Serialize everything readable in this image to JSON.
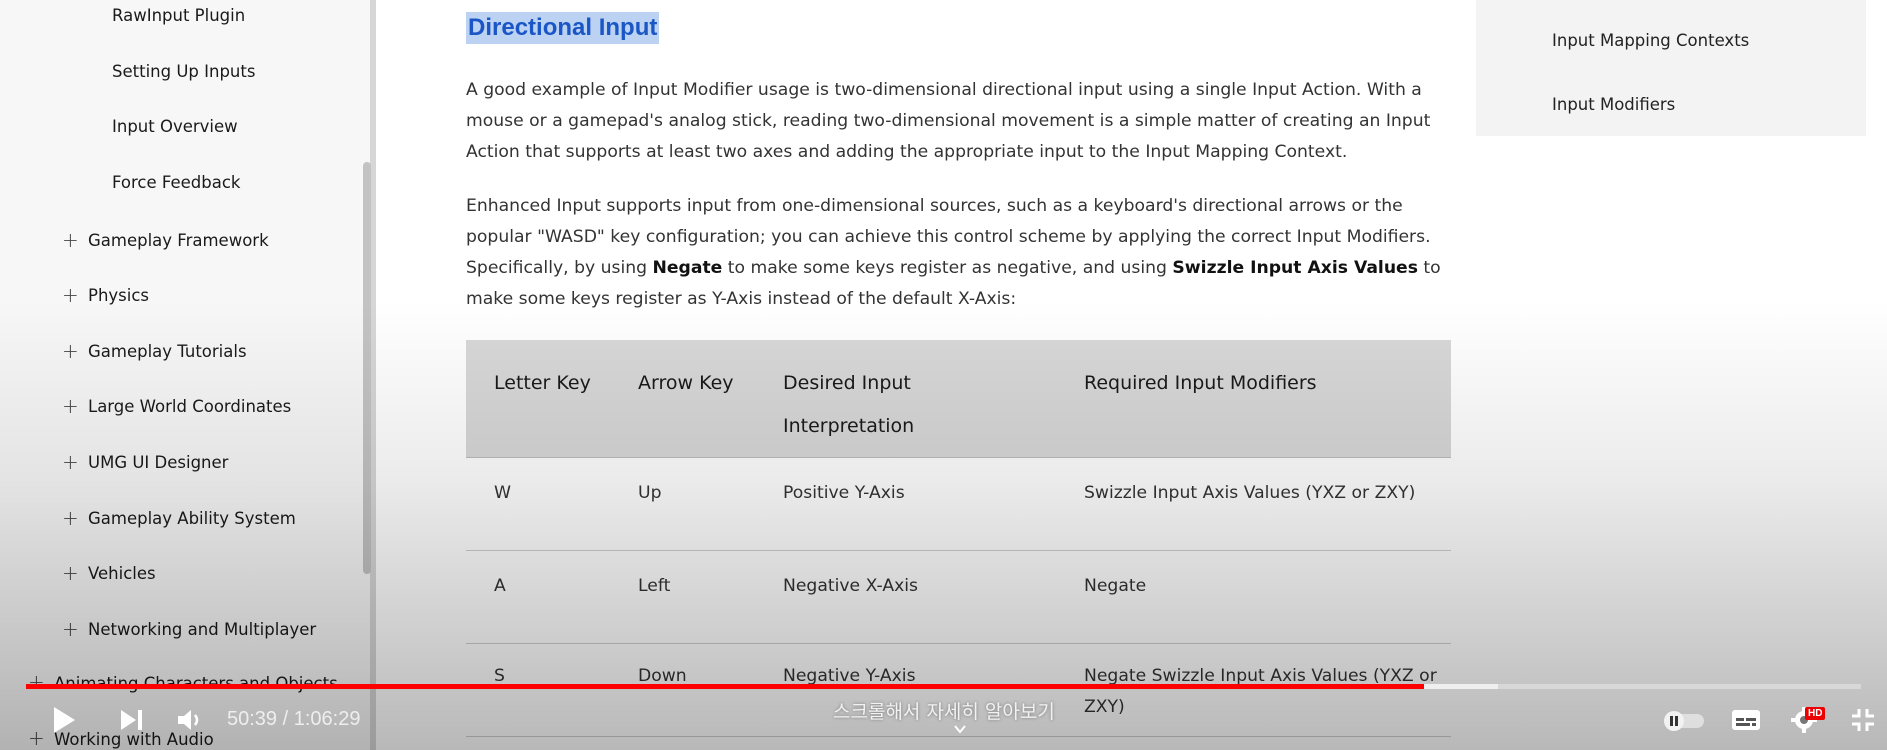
{
  "sidebar": {
    "sub_items": [
      {
        "label": "RawInput Plugin"
      },
      {
        "label": "Setting Up Inputs"
      },
      {
        "label": "Input Overview"
      },
      {
        "label": "Force Feedback"
      }
    ],
    "top_items": [
      {
        "label": "Gameplay Framework"
      },
      {
        "label": "Physics"
      },
      {
        "label": "Gameplay Tutorials"
      },
      {
        "label": "Large World Coordinates"
      },
      {
        "label": "UMG UI Designer"
      },
      {
        "label": "Gameplay Ability System"
      },
      {
        "label": "Vehicles"
      },
      {
        "label": "Networking and Multiplayer"
      }
    ],
    "root_items": [
      {
        "label": "Animating Characters and Objects"
      },
      {
        "label": "Working with Audio"
      }
    ]
  },
  "main": {
    "heading": "Directional Input",
    "para1": "A good example of Input Modifier usage is two-dimensional directional input using a single Input Action. With a mouse or a gamepad's analog stick, reading two-dimensional movement is a simple matter of creating an Input Action that supports at least two axes and adding the appropriate input to the Input Mapping Context.",
    "para2": {
      "part1": "Enhanced Input supports input from one-dimensional sources, such as a keyboard's directional arrows or the popular \"WASD\" key configuration; you can achieve this control scheme by applying the correct Input Modifiers. Specifically, by using ",
      "bold1": "Negate",
      "part2": " to make some keys register as negative, and using ",
      "bold2": "Swizzle Input Axis Values",
      "part3": " to make some keys register as Y-Axis instead of the default X-Axis:"
    },
    "table": {
      "headers": [
        "Letter Key",
        "Arrow Key",
        "Desired Input Interpretation",
        "Required Input Modifiers"
      ],
      "rows": [
        [
          "W",
          "Up",
          "Positive Y-Axis",
          "Swizzle Input Axis Values (YXZ or ZXY)"
        ],
        [
          "A",
          "Left",
          "Negative X-Axis",
          "Negate"
        ],
        [
          "S",
          "Down",
          "Negative Y-Axis",
          "Negate Swizzle Input Axis Values (YXZ or ZXY)"
        ]
      ]
    }
  },
  "toc": {
    "items": [
      {
        "label": "Input Mapping Contexts"
      },
      {
        "label": "Input Modifiers"
      }
    ]
  },
  "player": {
    "time": "50:39 / 1:06:29",
    "scroll_hint": "스크롤해서 자세히 알아보기",
    "hd_badge": "HD",
    "progress_played": 0.762,
    "accent": "#ff0000"
  }
}
